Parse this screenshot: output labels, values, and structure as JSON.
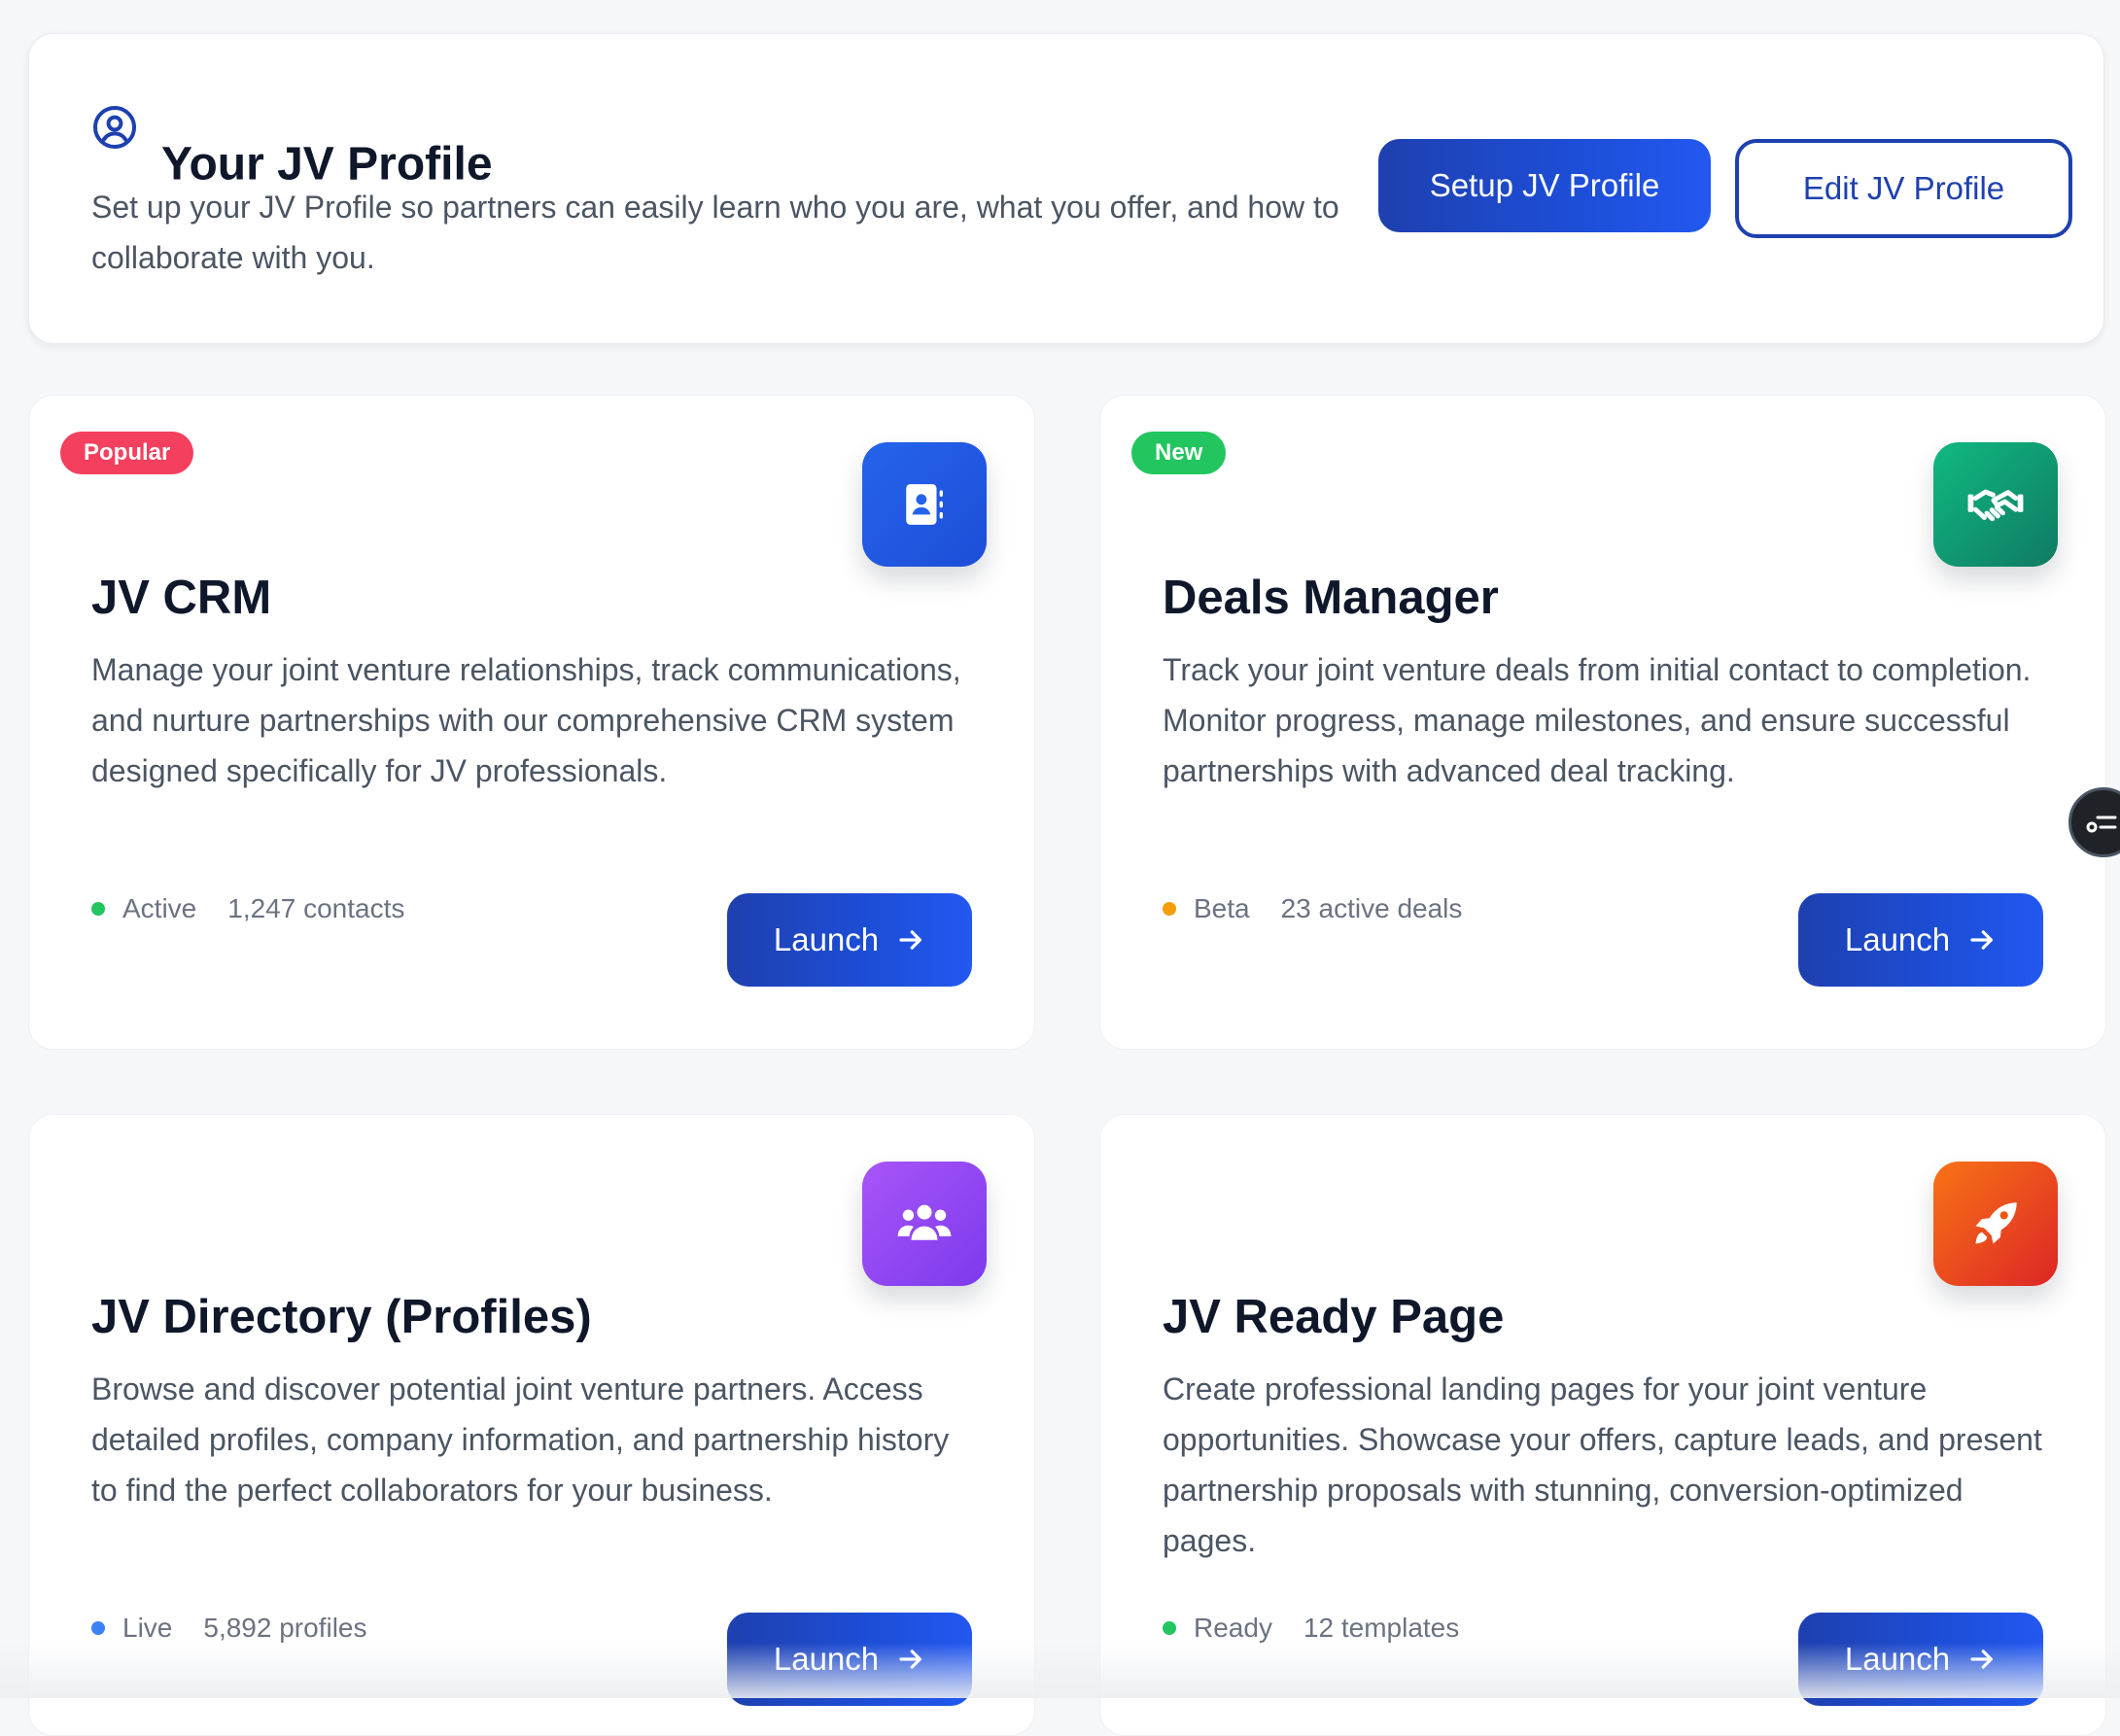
{
  "profile": {
    "title": "Your JV Profile",
    "description": "Set up your JV Profile so partners can easily learn who you are, what you offer, and how to collaborate with you.",
    "setup_label": "Setup JV Profile",
    "edit_label": "Edit JV Profile",
    "icon": "user-circle-icon"
  },
  "colors": {
    "primary": "#1e40af",
    "badge_popular": "#f43f5e",
    "badge_new": "#22c55e",
    "status_green": "#22c55e",
    "status_orange": "#f59e0b",
    "status_blue": "#3b82f6"
  },
  "tools": [
    {
      "badge": "Popular",
      "title": "JV CRM",
      "description": "Manage your joint venture relationships, track communications, and nurture partnerships with our comprehensive CRM system designed specifically for JV professionals.",
      "status": "Active",
      "metric": "1,247 contacts",
      "launch_label": "Launch",
      "icon": "contact-book-icon"
    },
    {
      "badge": "New",
      "title": "Deals Manager",
      "description": "Track your joint venture deals from initial contact to completion. Monitor progress, manage milestones, and ensure successful partnerships with advanced deal tracking.",
      "status": "Beta",
      "metric": "23 active deals",
      "launch_label": "Launch",
      "icon": "handshake-icon"
    },
    {
      "title": "JV Directory (Profiles)",
      "description": "Browse and discover potential joint venture partners. Access detailed profiles, company information, and partnership history to find the perfect collaborators for your business.",
      "status": "Live",
      "metric": "5,892 profiles",
      "launch_label": "Launch",
      "icon": "users-group-icon"
    },
    {
      "title": "JV Ready Page",
      "description": "Create professional landing pages for your joint venture opportunities. Showcase your offers, capture leads, and present partnership proposals with stunning, conversion-optimized pages.",
      "status": "Ready",
      "metric": "12 templates",
      "launch_label": "Launch",
      "icon": "rocket-icon"
    }
  ]
}
